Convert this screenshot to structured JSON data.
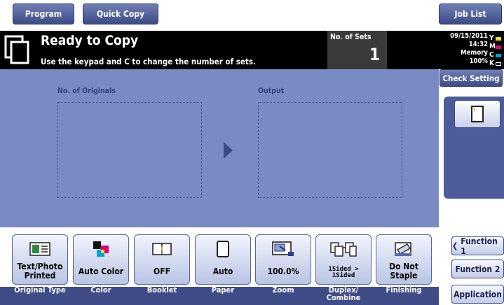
{
  "topbar": {
    "program_label": "Program",
    "quickcopy_label": "Quick Copy",
    "joblist_label": "Job List"
  },
  "status": {
    "title": "Ready to Copy",
    "message": "Use the keypad and C to change the number of sets.",
    "sets_label": "No. of Sets",
    "sets_value": "1",
    "date": "09/15/2011",
    "time": "14:32",
    "memory_label": "Memory",
    "memory_value": "100%",
    "inks": [
      "Y",
      "M",
      "C",
      "K"
    ],
    "ink_colors": [
      "#f2e000",
      "#e0007a",
      "#00a0e0",
      "#111111"
    ]
  },
  "main": {
    "originals_label": "No. of Originals",
    "output_label": "Output"
  },
  "right": {
    "check_setting_label": "Check Setting",
    "function1_label": "Function 1",
    "function2_label": "Function 2",
    "application_label": "Application"
  },
  "functions": [
    {
      "value": "Text/Photo\nPrinted",
      "caption": "Original Type",
      "icon": "original-type-icon"
    },
    {
      "value": "Auto Color",
      "caption": "Color",
      "icon": "color-icon"
    },
    {
      "value": "OFF",
      "caption": "Booklet",
      "icon": "booklet-icon"
    },
    {
      "value": "Auto",
      "caption": "Paper",
      "icon": "paper-icon"
    },
    {
      "value": "100.0%",
      "caption": "Zoom",
      "icon": "zoom-icon"
    },
    {
      "value": "1Sided >\n1Sided",
      "caption": "Duplex/\nCombine",
      "icon": "duplex-icon"
    },
    {
      "value": "Do Not\nStaple",
      "caption": "Finishing",
      "icon": "finishing-icon"
    }
  ],
  "colors": {
    "accent": "#3d4c86",
    "area": "#7a8ac3",
    "panel": "#4d5d9c"
  }
}
